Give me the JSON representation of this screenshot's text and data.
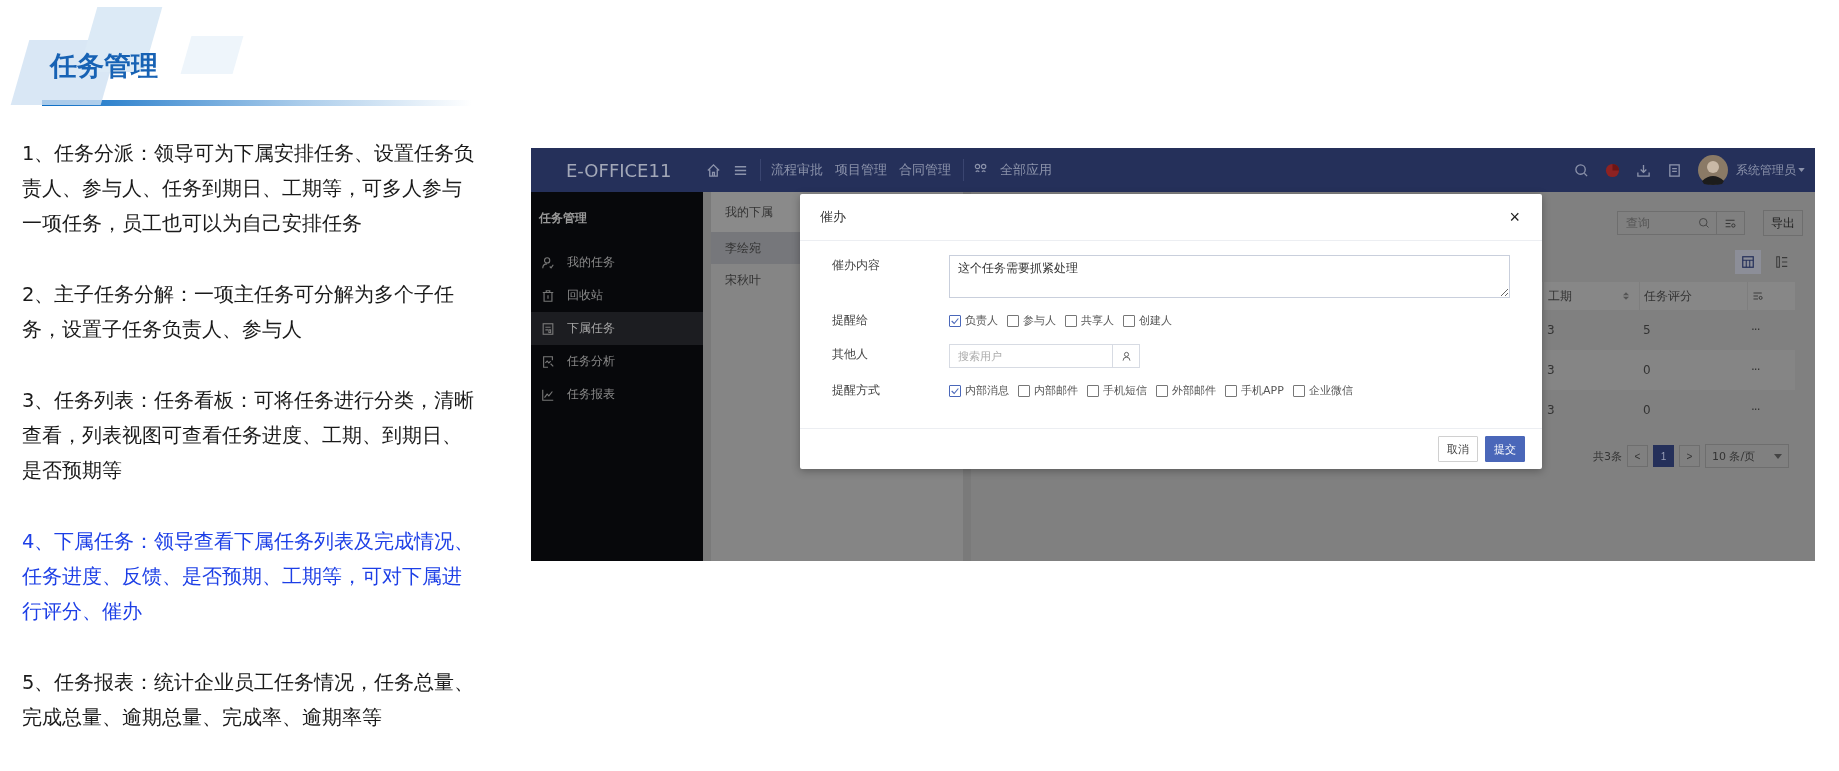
{
  "section": {
    "title": "任务管理"
  },
  "paragraphs": [
    {
      "text": "1、任务分派：领导可为下属安排任务、设置任务负责人、参与人、任务到期日、工期等，可多人参与一项任务，员工也可以为自己安排任务",
      "highlighted": false
    },
    {
      "text": "2、主子任务分解：一项主任务可分解为多个子任务，设置子任务负责人、参与人",
      "highlighted": false
    },
    {
      "text": "3、任务列表：任务看板：可将任务进行分类，清晰查看，列表视图可查看任务进度、工期、到期日、是否预期等",
      "highlighted": false
    },
    {
      "text": "4、下属任务：领导查看下属任务列表及完成情况、任务进度、反馈、是否预期、工期等，可对下属进行评分、催办",
      "highlighted": true
    },
    {
      "text": "5、任务报表：统计企业员工任务情况，任务总量、完成总量、逾期总量、完成率、逾期率等",
      "highlighted": false
    }
  ],
  "screenshot": {
    "app_bar": {
      "logo": "E-OFFICE11",
      "nav_items": [
        "流程审批",
        "项目管理",
        "合同管理",
        "全部应用"
      ],
      "user": "系统管理员"
    },
    "sidebar": {
      "title": "任务管理",
      "items": [
        {
          "label": "我的任务",
          "selected": false
        },
        {
          "label": "回收站",
          "selected": false
        },
        {
          "label": "下属任务",
          "selected": true
        },
        {
          "label": "任务分析",
          "selected": false
        },
        {
          "label": "任务报表",
          "selected": false
        }
      ]
    },
    "subordinates": {
      "title": "我的下属",
      "items": [
        {
          "name": "李绘宛",
          "selected": true
        },
        {
          "name": "宋秋叶",
          "selected": false
        }
      ]
    },
    "toolbar": {
      "search_placeholder": "查询",
      "export_button": "导出"
    },
    "views": [
      {
        "kind": "table",
        "selected": true
      },
      {
        "kind": "list",
        "selected": false
      }
    ],
    "table": {
      "columns": [
        "工期",
        "任务评分"
      ],
      "rows": [
        {
          "duration": "3",
          "score": "5",
          "more": "···"
        },
        {
          "duration": "3",
          "score": "0",
          "more": "···"
        },
        {
          "duration": "3",
          "score": "0",
          "more": "···"
        }
      ]
    },
    "pagination": {
      "total": "共3条",
      "prev": "<",
      "pages": [
        {
          "label": "1",
          "selected": true
        }
      ],
      "next": ">",
      "page_size": "10 条/页"
    },
    "dialog": {
      "title": "催办",
      "close": "×",
      "fields": [
        {
          "kind": "textarea",
          "label": "催办内容",
          "value": "这个任务需要抓紧处理"
        },
        {
          "kind": "checkboxes",
          "label": "提醒给",
          "options": [
            {
              "label": "负责人",
              "checked": true
            },
            {
              "label": "参与人",
              "checked": false
            },
            {
              "label": "共享人",
              "checked": false
            },
            {
              "label": "创建人",
              "checked": false
            }
          ]
        },
        {
          "kind": "user_search",
          "label": "其他人",
          "placeholder": "搜索用户"
        },
        {
          "kind": "checkboxes",
          "label": "提醒方式",
          "options": [
            {
              "label": "内部消息",
              "checked": true
            },
            {
              "label": "内部邮件",
              "checked": false
            },
            {
              "label": "手机短信",
              "checked": false
            },
            {
              "label": "外部邮件",
              "checked": false
            },
            {
              "label": "手机APP",
              "checked": false
            },
            {
              "label": "企业微信",
              "checked": false
            }
          ]
        }
      ],
      "buttons": [
        {
          "label": "取消",
          "primary": false
        },
        {
          "label": "提交",
          "primary": true
        }
      ]
    }
  }
}
